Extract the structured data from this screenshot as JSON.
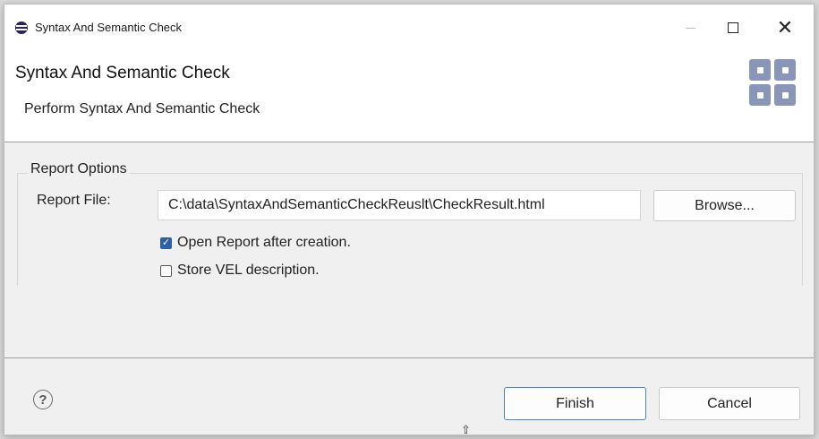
{
  "window": {
    "title": "Syntax And Semantic Check",
    "icon": "eclipse-icon",
    "minimize_icon": "minimize-icon",
    "maximize_icon": "maximize-icon",
    "close_glyph": "✕"
  },
  "header": {
    "title": "Syntax And Semantic Check",
    "description": "Perform Syntax And Semantic Check",
    "icon": "wizard-banner-icon"
  },
  "report_options": {
    "legend": "Report Options",
    "report_file_label": "Report File:",
    "report_file_value": "C:\\data\\SyntaxAndSemanticCheckReuslt\\CheckResult.html",
    "browse_label": "Browse...",
    "open_report": {
      "label": "Open Report after creation.",
      "checked": true
    },
    "store_vel": {
      "label": "Store VEL description.",
      "checked": false
    }
  },
  "footer": {
    "help_glyph": "?",
    "finish_label": "Finish",
    "cancel_label": "Cancel"
  },
  "colors": {
    "accent": "#2d5fa8",
    "focus_border": "#4a84c8",
    "banner_icon": "#8a96b8"
  }
}
